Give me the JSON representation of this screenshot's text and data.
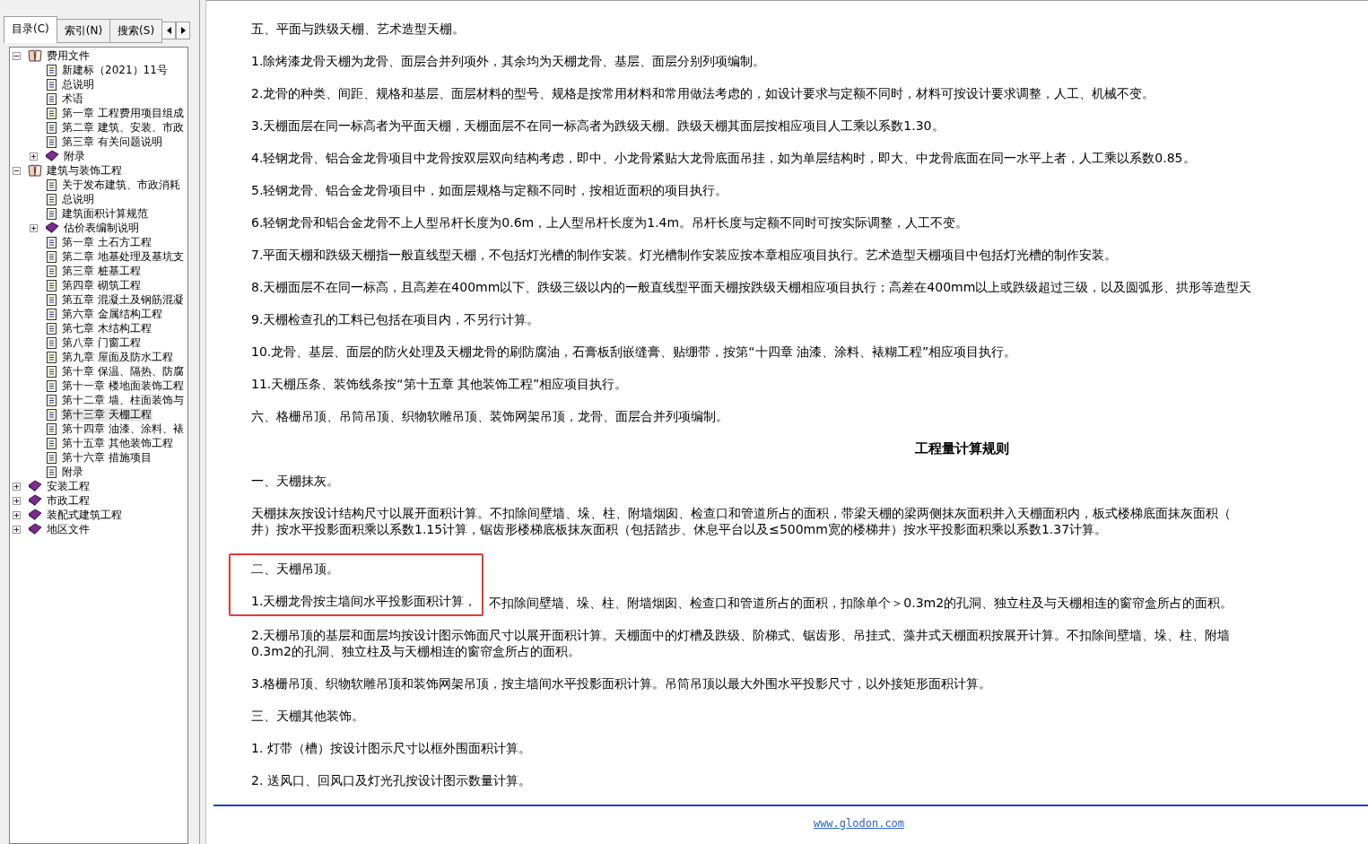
{
  "nav_tabs": [
    {
      "label": "目录(C)",
      "selected": true
    },
    {
      "label": "索引(N)",
      "selected": false
    },
    {
      "label": "搜索(S)",
      "selected": false
    }
  ],
  "tree": [
    {
      "label": "费用文件",
      "expanded": true,
      "selected": false,
      "children": [
        {
          "label": "新建标（2021）11号",
          "selected": false
        },
        {
          "label": "总说明",
          "selected": false
        },
        {
          "label": "术语",
          "selected": false
        },
        {
          "label": "第一章 工程费用项目组成",
          "selected": false
        },
        {
          "label": "第二章 建筑、安装、市政",
          "selected": false
        },
        {
          "label": "第三章 有关问题说明",
          "selected": false
        },
        {
          "label": "附录",
          "expanded": false,
          "selected": false
        }
      ]
    },
    {
      "label": "建筑与装饰工程",
      "expanded": true,
      "selected": false,
      "children": [
        {
          "label": "关于发布建筑、市政消耗",
          "selected": false
        },
        {
          "label": "总说明",
          "selected": false
        },
        {
          "label": "建筑面积计算规范",
          "selected": false
        },
        {
          "label": "估价表编制说明",
          "expanded": false,
          "selected": false
        },
        {
          "label": "第一章 土石方工程",
          "selected": false
        },
        {
          "label": "第二章 地基处理及基坑支",
          "selected": false
        },
        {
          "label": "第三章 桩基工程",
          "selected": false
        },
        {
          "label": "第四章 砌筑工程",
          "selected": false
        },
        {
          "label": "第五章 混凝土及钢筋混凝",
          "selected": false
        },
        {
          "label": "第六章 金属结构工程",
          "selected": false
        },
        {
          "label": "第七章 木结构工程",
          "selected": false
        },
        {
          "label": "第八章 门窗工程",
          "selected": false
        },
        {
          "label": "第九章 屋面及防水工程",
          "selected": false
        },
        {
          "label": "第十章 保温、隔热、防腐",
          "selected": false
        },
        {
          "label": "第十一章 楼地面装饰工程",
          "selected": false
        },
        {
          "label": "第十二章 墙、柱面装饰与",
          "selected": false
        },
        {
          "label": "第十三章 天棚工程",
          "selected": true
        },
        {
          "label": "第十四章 油漆、涂料、裱",
          "selected": false
        },
        {
          "label": "第十五章 其他装饰工程",
          "selected": false
        },
        {
          "label": "第十六章 措施项目",
          "selected": false
        },
        {
          "label": "附录",
          "selected": false
        }
      ]
    },
    {
      "label": "安装工程",
      "expanded": false,
      "selected": false
    },
    {
      "label": "市政工程",
      "expanded": false,
      "selected": false
    },
    {
      "label": "装配式建筑工程",
      "expanded": false,
      "selected": false
    },
    {
      "label": "地区文件",
      "expanded": false,
      "selected": false
    }
  ],
  "document": [
    {
      "kind": "para",
      "lines": [
        "五、平面与跌级天棚、艺术造型天棚。"
      ]
    },
    {
      "kind": "para",
      "lines": [
        "1.除烤漆龙骨天棚为龙骨、面层合并列项外，其余均为天棚龙骨、基层、面层分别列项编制。"
      ]
    },
    {
      "kind": "para",
      "lines": [
        "2.龙骨的种类、间距、规格和基层、面层材料的型号、规格是按常用材料和常用做法考虑的，如设计要求与定额不同时，材料可按设计要求调整，人工、机械不变。"
      ]
    },
    {
      "kind": "para",
      "lines": [
        "3.天棚面层在同一标高者为平面天棚，天棚面层不在同一标高者为跌级天棚。跌级天棚其面层按相应项目人工乘以系数1.30。"
      ]
    },
    {
      "kind": "para",
      "lines": [
        "4.轻钢龙骨、铝合金龙骨项目中龙骨按双层双向结构考虑，即中、小龙骨紧贴大龙骨底面吊挂，如为单层结构时，即大、中龙骨底面在同一水平上者，人工乘以系数0.85。"
      ]
    },
    {
      "kind": "para",
      "lines": [
        "5.轻钢龙骨、铝合金龙骨项目中，如面层规格与定额不同时，按相近面积的项目执行。"
      ]
    },
    {
      "kind": "para",
      "lines": [
        "6.轻钢龙骨和铝合金龙骨不上人型吊杆长度为0.6m，上人型吊杆长度为1.4m。吊杆长度与定额不同时可按实际调整，人工不变。"
      ]
    },
    {
      "kind": "para",
      "lines": [
        "7.平面天棚和跌级天棚指一般直线型天棚，不包括灯光槽的制作安装。灯光槽制作安装应按本章相应项目执行。艺术造型天棚项目中包括灯光槽的制作安装。"
      ]
    },
    {
      "kind": "para",
      "lines": [
        "8.天棚面层不在同一标高，且高差在400mm以下、跌级三级以内的一般直线型平面天棚按跌级天棚相应项目执行；高差在400mm以上或跌级超过三级，以及圆弧形、拱形等造型天"
      ]
    },
    {
      "kind": "para",
      "lines": [
        "9.天棚检查孔的工料已包括在项目内，不另行计算。"
      ]
    },
    {
      "kind": "para",
      "lines": [
        "10.龙骨、基层、面层的防火处理及天棚龙骨的刷防腐油，石膏板刮嵌缝膏、贴绷带，按第“十四章 油漆、涂料、裱糊工程”相应项目执行。"
      ]
    },
    {
      "kind": "para",
      "lines": [
        "11.天棚压条、装饰线条按“第十五章 其他装饰工程”相应项目执行。"
      ]
    },
    {
      "kind": "para",
      "lines": [
        "六、格栅吊顶、吊筒吊顶、织物软雕吊顶、装饰网架吊顶，龙骨、面层合并列项编制。"
      ]
    },
    {
      "kind": "title",
      "lines": [
        "工程量计算规则"
      ]
    },
    {
      "kind": "para",
      "lines": [
        "一、天棚抹灰。"
      ]
    },
    {
      "kind": "para",
      "lines": [
        "天棚抹灰按设计结构尺寸以展开面积计算。不扣除间壁墙、垛、柱、附墙烟囱、检查口和管道所占的面积，带梁天棚的梁两侧抹灰面积并入天棚面积内，板式楼梯底面抹灰面积（",
        "井）按水平投影面积乘以系数1.15计算，锯齿形楼梯底板抹灰面积（包括踏步、休息平台以及≤500mm宽的楼梯井）按水平投影面积乘以系数1.37计算。"
      ]
    },
    {
      "kind": "highlight",
      "lines": [
        "二、天棚吊顶。",
        "1.天棚龙骨按主墙间水平投影面积计算，"
      ],
      "after": "不扣除间壁墙、垛、柱、附墙烟囱、检查口和管道所占的面积，扣除单个＞0.3m2的孔洞、独立柱及与天棚相连的窗帘盒所占的面积。"
    },
    {
      "kind": "para",
      "lines": [
        "2.天棚吊顶的基层和面层均按设计图示饰面尺寸以展开面积计算。天棚面中的灯槽及跌级、阶梯式、锯齿形、吊挂式、藻井式天棚面积按展开计算。不扣除间壁墙、垛、柱、附墙",
        "0.3m2的孔洞、独立柱及与天棚相连的窗帘盒所占的面积。"
      ]
    },
    {
      "kind": "para",
      "lines": [
        "3.格栅吊顶、织物软雕吊顶和装饰网架吊顶，按主墙间水平投影面积计算。吊筒吊顶以最大外围水平投影尺寸，以外接矩形面积计算。"
      ]
    },
    {
      "kind": "para",
      "lines": [
        "三、天棚其他装饰。"
      ]
    },
    {
      "kind": "para",
      "lines": [
        "1. 灯带（槽）按设计图示尺寸以框外围面积计算。"
      ]
    },
    {
      "kind": "para",
      "lines": [
        "2. 送风口、回风口及灯光孔按设计图示数量计算。"
      ]
    }
  ],
  "footer_link": "www.glodon.com"
}
